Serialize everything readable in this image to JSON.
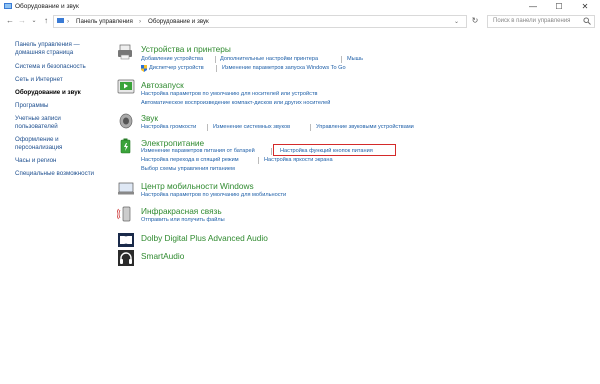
{
  "window": {
    "title": "Оборудование и звук",
    "minimize_icon": "minimize-icon",
    "maximize_icon": "maximize-icon",
    "close_icon": "close-icon"
  },
  "address": {
    "crumbs": [
      "Панель управления",
      "Оборудование и звук"
    ],
    "search_placeholder": "Поиск в панели управления"
  },
  "sidebar": {
    "items": [
      {
        "label": "Панель управления —"
      },
      {
        "label": "домашняя страница"
      },
      {
        "label": "Система и безопасность"
      },
      {
        "label": "Сеть и Интернет"
      },
      {
        "label": "Оборудование и звук"
      },
      {
        "label": "Программы"
      },
      {
        "label": "Учетные записи"
      },
      {
        "label": "пользователей"
      },
      {
        "label": "Оформление и"
      },
      {
        "label": "персонализация"
      },
      {
        "label": "Часы и регион"
      },
      {
        "label": "Специальные возможности"
      }
    ]
  },
  "categories": [
    {
      "title": "Устройства и принтеры",
      "links": [
        "Добавление устройства",
        "Дополнительные настройки принтера",
        "Мышь",
        "Диспетчер устройств",
        "Изменение параметров запуска Windows To Go"
      ]
    },
    {
      "title": "Автозапуск",
      "links": [
        "Настройка параметров по умолчанию для носителей или устройств",
        "Автоматическое воспроизведение компакт-дисков или других носителей"
      ]
    },
    {
      "title": "Звук",
      "links": [
        "Настройка громкости",
        "Изменение системных звуков",
        "Управление звуковыми устройствами"
      ]
    },
    {
      "title": "Электропитание",
      "links": [
        "Изменение параметров питания от батарей",
        "Настройка функций кнопок питания",
        "Настройка перехода в спящий режим",
        "Настройка яркости экрана",
        "Выбор схемы управления питанием"
      ]
    },
    {
      "title": "Центр мобильности Windows",
      "links": [
        "Настройка параметров по умолчанию для мобильности"
      ]
    },
    {
      "title": "Инфракрасная связь",
      "links": [
        "Отправить или получить файлы"
      ]
    },
    {
      "title": "Dolby Digital Plus Advanced Audio",
      "links": []
    },
    {
      "title": "SmartAudio",
      "links": []
    }
  ],
  "colors": {
    "category_title": "#2f8a2f",
    "link": "#1e5fa8",
    "highlight": "#d42a2a"
  }
}
